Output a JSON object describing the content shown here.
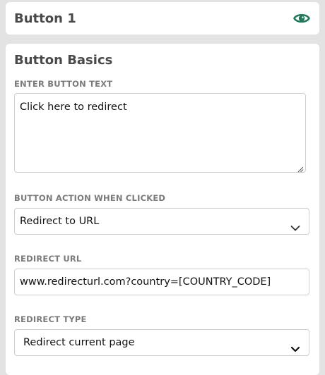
{
  "header": {
    "title": "Button 1",
    "visibility_icon": "eye-icon",
    "accent_color": "#1f7a5c"
  },
  "section": {
    "title": "Button Basics"
  },
  "button_text": {
    "label": "ENTER BUTTON TEXT",
    "value": "Click here to redirect"
  },
  "button_action": {
    "label": "BUTTON ACTION WHEN CLICKED",
    "value": "Redirect to URL",
    "icon": "chevron-down-icon"
  },
  "redirect_url": {
    "label": "REDIRECT URL",
    "value": "www.redirecturl.com?country=[COUNTRY_CODE]"
  },
  "redirect_type": {
    "label": "REDIRECT TYPE",
    "value": "Redirect current page",
    "icon": "chevron-down-icon"
  }
}
